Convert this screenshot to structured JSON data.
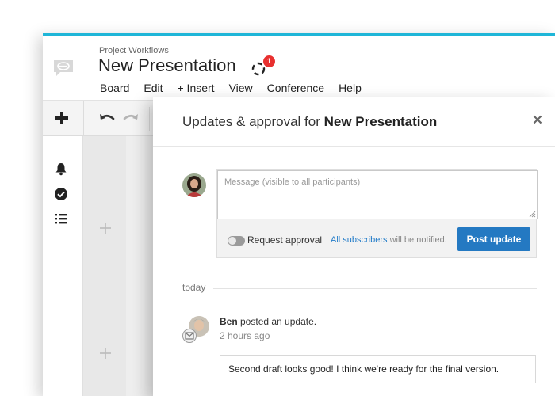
{
  "app": {
    "logo_icon": "chat-bubble-logo-icon",
    "accent_color": "#1fb6d8"
  },
  "header": {
    "breadcrumb": "Project Workflows",
    "title": "New Presentation",
    "sync_icon": "sync-icon",
    "notification_count": "1"
  },
  "menu": {
    "items": [
      "Board",
      "Edit",
      "+ Insert",
      "View",
      "Conference",
      "Help"
    ]
  },
  "toolbar": {
    "add_icon": "plus-icon",
    "undo_icon": "undo-icon",
    "redo_icon": "redo-icon"
  },
  "left_rail": {
    "icons": [
      "bell-icon",
      "check-circle-icon",
      "list-icon"
    ]
  },
  "panel": {
    "title_prefix": "Updates & approval for ",
    "title_name": "New Presentation",
    "close_icon": "close-icon",
    "composer": {
      "placeholder": "Message (visible to all participants)",
      "value": "",
      "request_approval_label": "Request approval",
      "request_approval_on": false,
      "notify_link": "All subscribers",
      "notify_suffix": " will be notified.",
      "post_button_label": "Post update",
      "button_color": "#2479c2"
    },
    "timeline": {
      "date_label": "today",
      "entries": [
        {
          "author": "Ben",
          "action": " posted an update.",
          "time": "2 hours ago",
          "comment": "Second draft looks good! I think we're ready for the final version."
        }
      ]
    }
  }
}
